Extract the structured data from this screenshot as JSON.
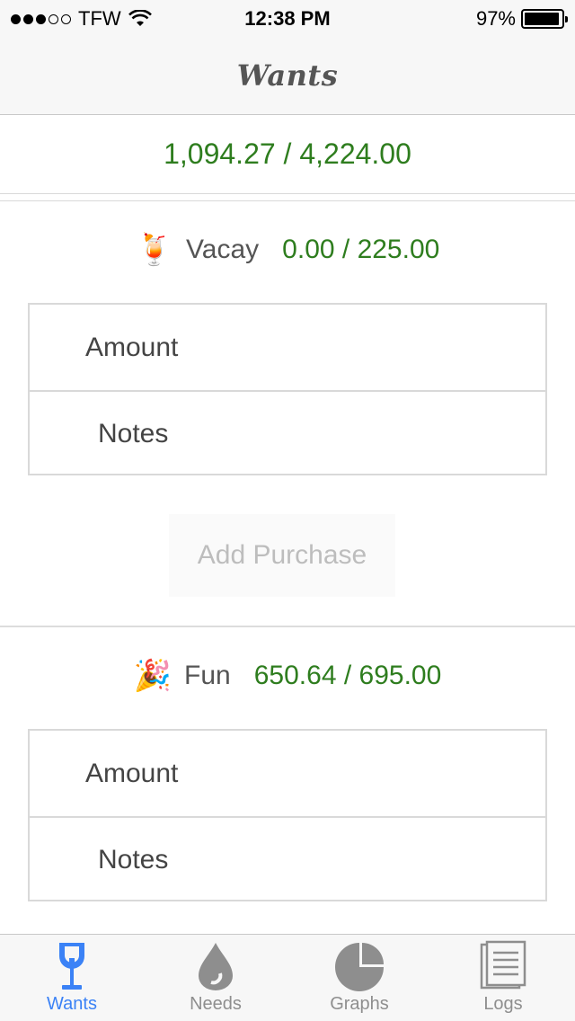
{
  "status_bar": {
    "carrier": "TFW",
    "time": "12:38 PM",
    "battery": "97%"
  },
  "nav": {
    "title": "Wants"
  },
  "total": {
    "text": "1,094.27 / 4,224.00"
  },
  "categories": [
    {
      "emoji": "🍹",
      "name": "Vacay",
      "value": "0.00 / 225.00",
      "amount_placeholder": "Amount",
      "notes_placeholder": "Notes",
      "add_label": "Add Purchase"
    },
    {
      "emoji": "🎉",
      "name": "Fun",
      "value": "650.64 / 695.00",
      "amount_placeholder": "Amount",
      "notes_placeholder": "Notes"
    }
  ],
  "tabs": [
    {
      "label": "Wants",
      "icon": "wine-glass-icon",
      "active": true
    },
    {
      "label": "Needs",
      "icon": "drop-icon",
      "active": false
    },
    {
      "label": "Graphs",
      "icon": "pie-chart-icon",
      "active": false
    },
    {
      "label": "Logs",
      "icon": "document-list-icon",
      "active": false
    }
  ],
  "colors": {
    "positive": "#2e7d1e",
    "accent": "#3b82f6",
    "inactive": "#8e8e8e"
  }
}
